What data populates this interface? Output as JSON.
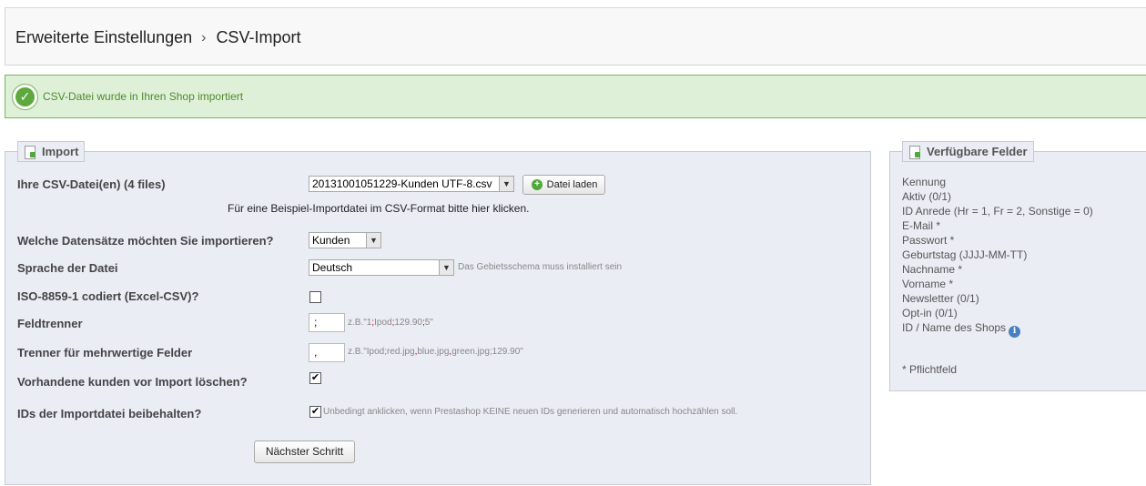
{
  "breadcrumb": {
    "parent": "Erweiterte Einstellungen",
    "separator": "›",
    "current": "CSV-Import"
  },
  "success": {
    "message": "CSV-Datei wurde in Ihren Shop importiert",
    "icon": "check-icon",
    "color": "#dff0d8"
  },
  "import_panel": {
    "legend": "Import",
    "csv_files_label": "Ihre CSV-Datei(en) (4 files)",
    "csv_file_selected": "20131001051229-Kunden UTF-8.csv",
    "load_file_button": "Datei laden",
    "example_note": "Für eine Beispiel-Importdatei im CSV-Format bitte hier klicken.",
    "entity_label": "Welche Datensätze möchten Sie importieren?",
    "entity_selected": "Kunden",
    "language_label": "Sprache der Datei",
    "language_selected": "Deutsch",
    "language_hint": "Das Gebietsschema muss installiert sein",
    "iso_label": "ISO-8859-1 codiert (Excel-CSV)?",
    "iso_checked": false,
    "field_separator_label": "Feldtrenner",
    "field_separator_value": ";",
    "field_separator_hint": {
      "prefix": "z.B.\"1",
      "sep": ";",
      "a": "Ipod",
      "b": "129.90",
      "c": "5\""
    },
    "multi_separator_label": "Trenner für mehrwertige Felder",
    "multi_separator_value": ",",
    "multi_separator_hint": {
      "prefix": "z.B.\"Ipod;red.jpg",
      "sep": ",",
      "a": "blue.jpg",
      "b": "green.jpg;129.90\""
    },
    "delete_label": "Vorhandene kunden vor Import löschen?",
    "delete_checked": true,
    "keep_ids_label": "IDs der Importdatei beibehalten?",
    "keep_ids_checked": true,
    "keep_ids_hint": "Unbedingt anklicken, wenn Prestashop KEINE neuen IDs generieren und automatisch hochzählen soll.",
    "next_button": "Nächster Schritt",
    "check_mark": "✔"
  },
  "fields_panel": {
    "legend": "Verfügbare Felder",
    "fields": [
      "Kennung",
      "Aktiv (0/1)",
      "ID Anrede (Hr = 1, Fr = 2, Sonstige = 0)",
      "E-Mail *",
      "Passwort *",
      "Geburtstag (JJJJ-MM-TT)",
      "Nachname *",
      "Vorname *",
      "Newsletter (0/1)",
      "Opt-in (0/1)",
      "ID / Name des Shops"
    ],
    "info_icon": "info-icon",
    "required_note": "* Pflichtfeld"
  }
}
